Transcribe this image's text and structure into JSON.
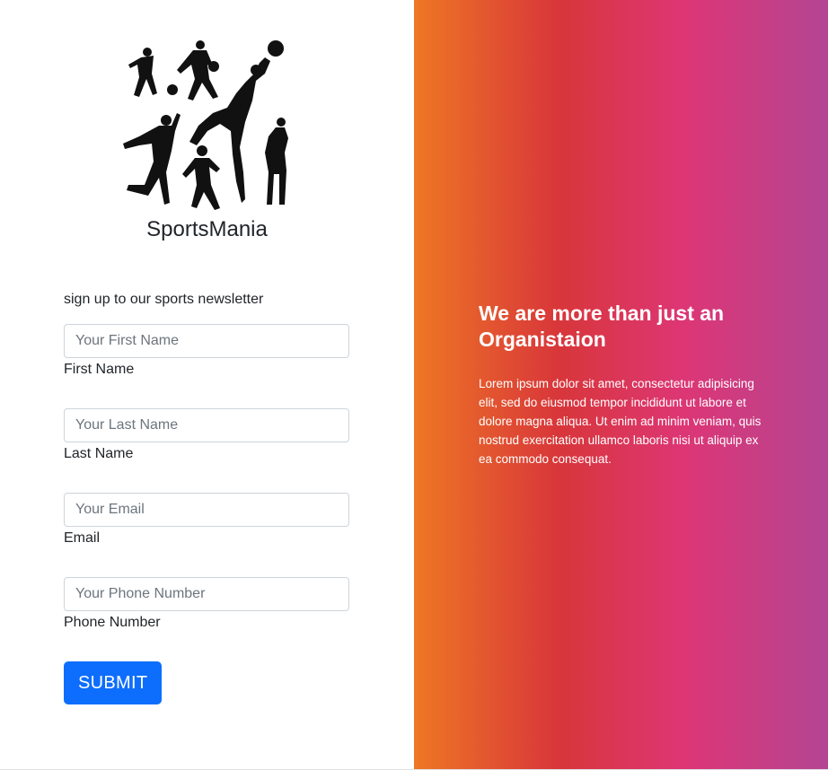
{
  "brand": {
    "name": "SportsMania",
    "logo_icon": "sports-silhouettes-logo"
  },
  "form": {
    "intro": "sign up to our sports newsletter",
    "fields": [
      {
        "placeholder": "Your First Name",
        "label": "First Name",
        "value": ""
      },
      {
        "placeholder": "Your Last Name",
        "label": "Last Name",
        "value": ""
      },
      {
        "placeholder": "Your Email",
        "label": "Email",
        "value": ""
      },
      {
        "placeholder": "Your Phone Number",
        "label": "Phone Number",
        "value": ""
      }
    ],
    "submit_label": "SUBMIT"
  },
  "panel": {
    "title": "We are more than just an Organistaion",
    "text": "Lorem ipsum dolor sit amet, consectetur adipisicing elit, sed do eiusmod tempor incididunt ut labore et dolore magna aliqua. Ut enim ad minim veniam, quis nostrud exercitation ullamco laboris nisi ut aliquip ex ea commodo consequat."
  },
  "colors": {
    "gradient": [
      "#ee7724",
      "#d8363a",
      "#dd3675",
      "#b44593"
    ],
    "button": "#0d6efd"
  }
}
